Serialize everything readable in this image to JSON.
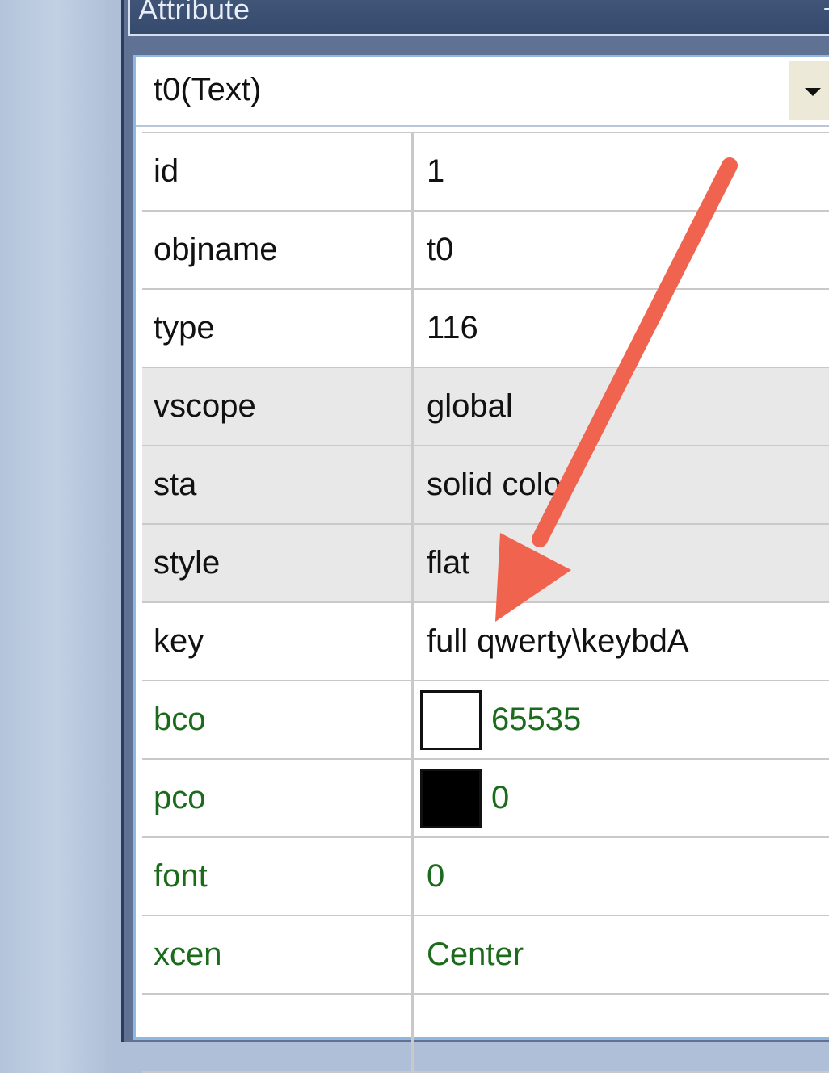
{
  "panel": {
    "title": "Attribute",
    "pin_icon": "pin-icon",
    "object_selector": {
      "value": "t0(Text)"
    }
  },
  "attributes": [
    {
      "key": "id",
      "value": "1",
      "shaded": false,
      "green": false
    },
    {
      "key": "objname",
      "value": "t0",
      "shaded": false,
      "green": false
    },
    {
      "key": "type",
      "value": "116",
      "shaded": false,
      "green": false
    },
    {
      "key": "vscope",
      "value": "global",
      "shaded": true,
      "green": false
    },
    {
      "key": "sta",
      "value": "solid color",
      "shaded": true,
      "green": false
    },
    {
      "key": "style",
      "value": "flat",
      "shaded": true,
      "green": false
    },
    {
      "key": "key",
      "value": "full qwerty\\keybdA",
      "shaded": false,
      "green": false
    },
    {
      "key": "bco",
      "value": "65535",
      "shaded": false,
      "green": true,
      "swatch": "#ffffff"
    },
    {
      "key": "pco",
      "value": "0",
      "shaded": false,
      "green": true,
      "swatch": "#000000"
    },
    {
      "key": "font",
      "value": "0",
      "shaded": false,
      "green": true
    },
    {
      "key": "xcen",
      "value": "Center",
      "shaded": false,
      "green": true
    },
    {
      "key": "",
      "value": "",
      "shaded": false,
      "green": true
    }
  ],
  "colors": {
    "title_bar": "#3d5175",
    "green_text": "#1c6b1c",
    "annotation_arrow": "#f0634f"
  }
}
